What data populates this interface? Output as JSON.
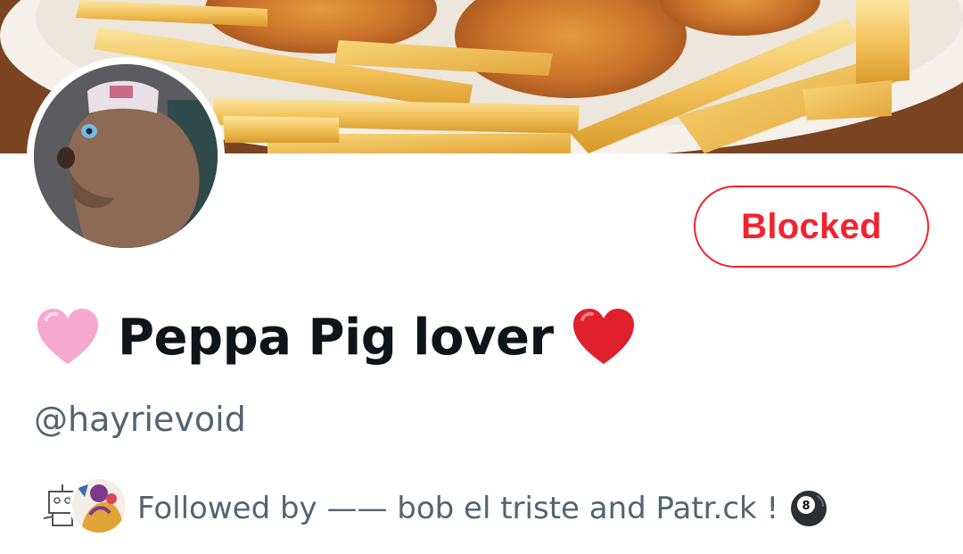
{
  "profile": {
    "display_name": "Peppa Pig lover",
    "name_prefix_emoji": "pink-heart",
    "name_suffix_emoji": "red-heart",
    "handle": "@hayrievoid",
    "banner_description_icon": "fries-and-chicken-banner",
    "avatar_icon": "puppet-avatar"
  },
  "actions": {
    "blocked_label": "Blocked"
  },
  "followed_by": {
    "text": "Followed by —— bob el triste and Patr.ck ! ",
    "suffix_emoji": "pool-8-ball",
    "avatars": [
      "robot-drawing-avatar",
      "colorful-drawing-avatar"
    ]
  },
  "colors": {
    "blocked_red": "#f4212e",
    "secondary_text": "#536471",
    "primary_text": "#0f1419",
    "pink_heart": "#f7a8cf",
    "red_heart": "#e0202c"
  }
}
